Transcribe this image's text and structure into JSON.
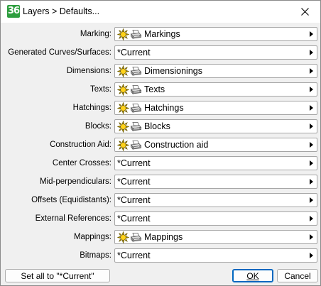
{
  "window": {
    "app_icon_text": "36",
    "title": "Layers > Defaults..."
  },
  "rows": [
    {
      "label": "Marking:",
      "value": "Markings",
      "has_icons": true
    },
    {
      "label": "Generated Curves/Surfaces:",
      "value": "*Current",
      "has_icons": false
    },
    {
      "label": "Dimensions:",
      "value": "Dimensionings",
      "has_icons": true
    },
    {
      "label": "Texts:",
      "value": "Texts",
      "has_icons": true
    },
    {
      "label": "Hatchings:",
      "value": "Hatchings",
      "has_icons": true
    },
    {
      "label": "Blocks:",
      "value": "Blocks",
      "has_icons": true
    },
    {
      "label": "Construction Aid:",
      "value": "Construction aid",
      "has_icons": true
    },
    {
      "label": "Center Crosses:",
      "value": "*Current",
      "has_icons": false
    },
    {
      "label": "Mid-perpendiculars:",
      "value": "*Current",
      "has_icons": false
    },
    {
      "label": "Offsets (Equidistants):",
      "value": "*Current",
      "has_icons": false
    },
    {
      "label": "External References:",
      "value": "*Current",
      "has_icons": false
    },
    {
      "label": "Mappings:",
      "value": "Mappings",
      "has_icons": true
    },
    {
      "label": "Bitmaps:",
      "value": "*Current",
      "has_icons": false
    }
  ],
  "buttons": {
    "set_all": "Set all to \"*Current\"",
    "ok": "OK",
    "cancel": "Cancel"
  },
  "icons": {
    "visible_icon": "sun-icon",
    "printable_icon": "printer-icon",
    "close": "close-icon",
    "dropdown": "dropdown-arrow-icon"
  },
  "colors": {
    "app_icon": "#2e9e3f",
    "sun": "#f5c400",
    "default_button_border": "#0067c0"
  }
}
